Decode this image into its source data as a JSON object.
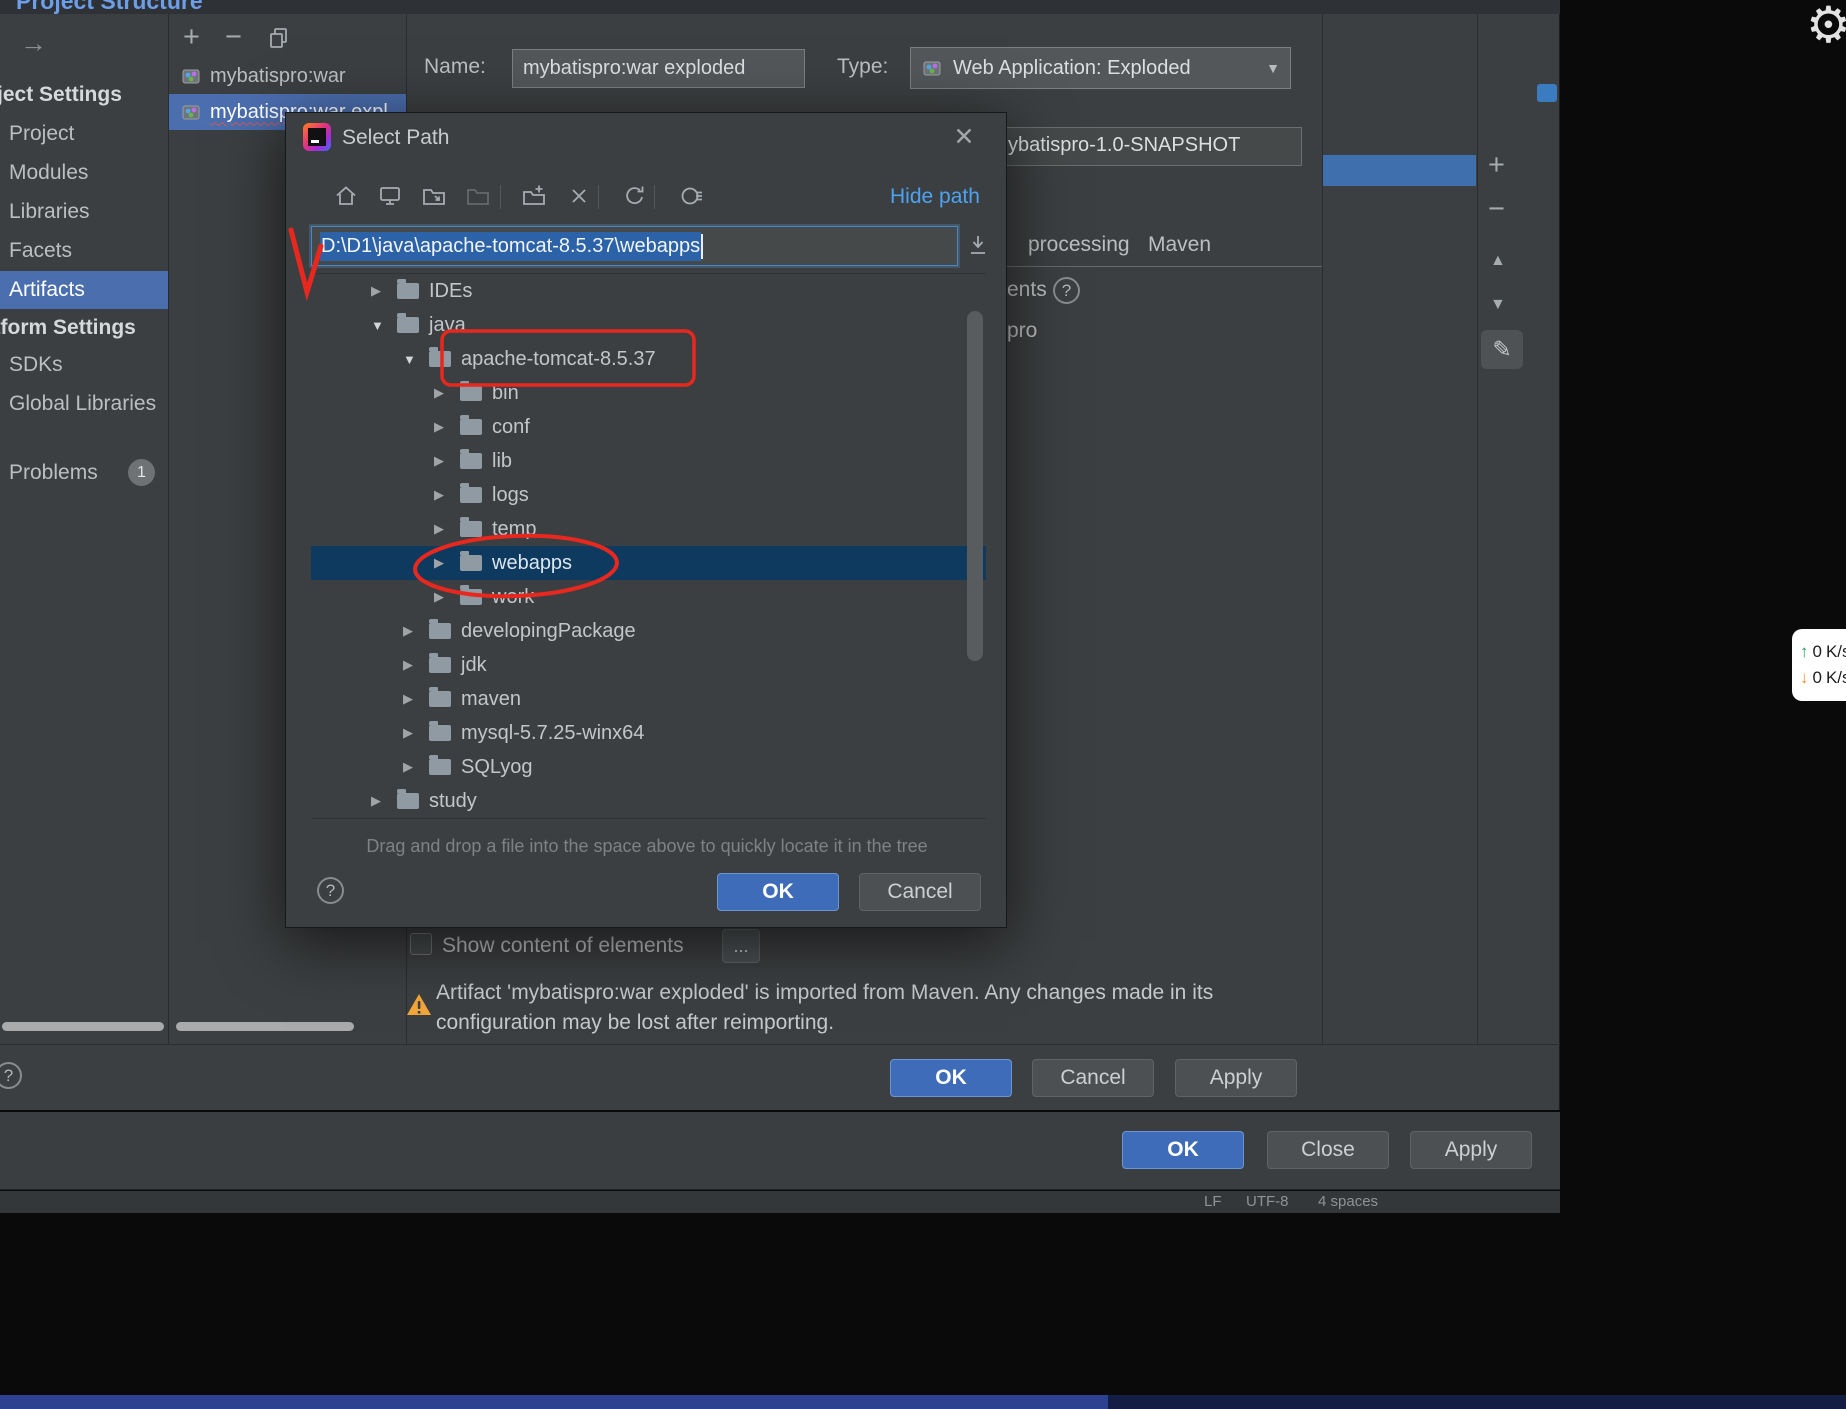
{
  "window_title": "Project Structure",
  "icons": {
    "back_arrow": "→",
    "gear": "⚙",
    "close": "✕",
    "plus": "+",
    "minus": "−",
    "up_arrow": "▲",
    "down_arrow": "▼",
    "pencil": "✎",
    "collapsed": "▶",
    "expanded": "▼",
    "dropdown": "▼",
    "help": "?",
    "net_up": "↑",
    "net_down": "↓"
  },
  "sidebar": {
    "sections": [
      {
        "header": "Project Settings",
        "items": [
          "Project",
          "Modules",
          "Libraries",
          "Facets",
          "Artifacts"
        ]
      },
      {
        "header": "Platform Settings",
        "items": [
          "SDKs",
          "Global Libraries"
        ]
      }
    ],
    "problems": {
      "label": "Problems",
      "count": "1"
    }
  },
  "artifacts_list": {
    "items": [
      "mybatispro:war",
      "mybatispro:war expl"
    ]
  },
  "editor": {
    "name_label": "Name:",
    "name_value": "mybatispro:war exploded",
    "type_label": "Type:",
    "type_value": "Web Application: Exploded",
    "output_value": "ybatispro-1.0-SNAPSHOT",
    "tab_processing": "processing",
    "tab_maven": "Maven",
    "elements_fragment": "ents",
    "tree_fragment": "pro",
    "show_content_label": "Show content of elements",
    "more_button": "...",
    "warning_line1": "Artifact 'mybatispro:war exploded' is imported from Maven. Any changes made in its",
    "warning_line2": "configuration may be lost after reimporting.",
    "ok": "OK",
    "cancel": "Cancel",
    "apply": "Apply"
  },
  "select_path": {
    "title": "Select Path",
    "hide_path_link": "Hide path",
    "path_value": "D:\\D1\\java\\apache-tomcat-8.5.37\\webapps",
    "tree": [
      {
        "label": "IDEs",
        "level": 1,
        "expanded": false,
        "selected": false
      },
      {
        "label": "java",
        "level": 1,
        "expanded": true,
        "selected": false
      },
      {
        "label": "apache-tomcat-8.5.37",
        "level": 2,
        "expanded": true,
        "selected": false,
        "annotated": true
      },
      {
        "label": "bin",
        "level": 3,
        "expanded": false,
        "selected": false
      },
      {
        "label": "conf",
        "level": 3,
        "expanded": false,
        "selected": false
      },
      {
        "label": "lib",
        "level": 3,
        "expanded": false,
        "selected": false
      },
      {
        "label": "logs",
        "level": 3,
        "expanded": false,
        "selected": false
      },
      {
        "label": "temp",
        "level": 3,
        "expanded": false,
        "selected": false
      },
      {
        "label": "webapps",
        "level": 3,
        "expanded": false,
        "selected": true,
        "annotated": true
      },
      {
        "label": "work",
        "level": 3,
        "expanded": false,
        "selected": false
      },
      {
        "label": "developingPackage",
        "level": 2,
        "expanded": false,
        "selected": false
      },
      {
        "label": "jdk",
        "level": 2,
        "expanded": false,
        "selected": false
      },
      {
        "label": "maven",
        "level": 2,
        "expanded": false,
        "selected": false
      },
      {
        "label": "mysql-5.7.25-winx64",
        "level": 2,
        "expanded": false,
        "selected": false
      },
      {
        "label": "SQLyog",
        "level": 2,
        "expanded": false,
        "selected": false
      },
      {
        "label": "study",
        "level": 1,
        "expanded": false,
        "selected": false
      }
    ],
    "hint": "Drag and drop a file into the space above to quickly locate it in the tree",
    "ok": "OK",
    "cancel": "Cancel"
  },
  "background_dialog": {
    "ok": "OK",
    "close": "Close",
    "apply": "Apply"
  },
  "statusbar": {
    "fragments": [
      "LF",
      "UTF-8",
      "4 spaces"
    ]
  },
  "network_widget": {
    "up_value": "0",
    "up_unit": "K/s",
    "down_value": "0",
    "down_unit": "K/s"
  },
  "colors": {
    "panel_bg": "#3c3f41",
    "selection_blue": "#4b6eaf",
    "tree_selection_dark": "#0e3a5f",
    "primary_button": "#3e6cb8",
    "link_blue": "#4da3f1",
    "annotation_red": "#e8281e",
    "warning_yellow": "#f2a63a"
  }
}
